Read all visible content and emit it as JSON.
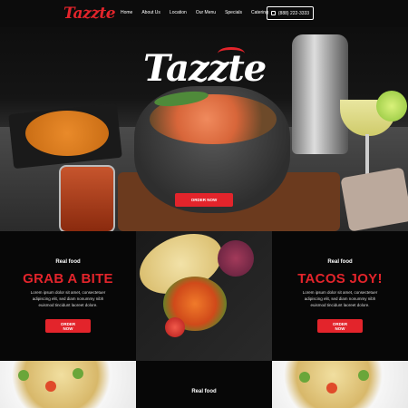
{
  "header": {
    "logo": "Tazzte",
    "nav": [
      "Home",
      "About Us",
      "Location",
      "Our Menu",
      "Specials",
      "Catering"
    ],
    "phone": "(888) 222-3333"
  },
  "hero": {
    "logo": "Tazzte",
    "cta": "ORDER NOW"
  },
  "sections": [
    {
      "label": "Real food",
      "title": "GRAB A BITE",
      "body": "Lorem ipsum dolor sit amet, consectetuer adipiscing elit, sed diam nonummy nibh euismod tincidunt laoreet dolore.",
      "cta": "ORDER NOW"
    },
    {
      "label": "Real food",
      "title": "TACOS JOY!",
      "body": "Lorem ipsum dolor sit amet, consectetuer adipiscing elit, sed diam nonummy nibh euismod tincidunt laoreet dolore.",
      "cta": "ORDER NOW"
    },
    {
      "label": "Real food"
    }
  ],
  "colors": {
    "accent": "#e3242b",
    "background": "#070707"
  },
  "icons": {
    "phone": "phone-icon"
  }
}
